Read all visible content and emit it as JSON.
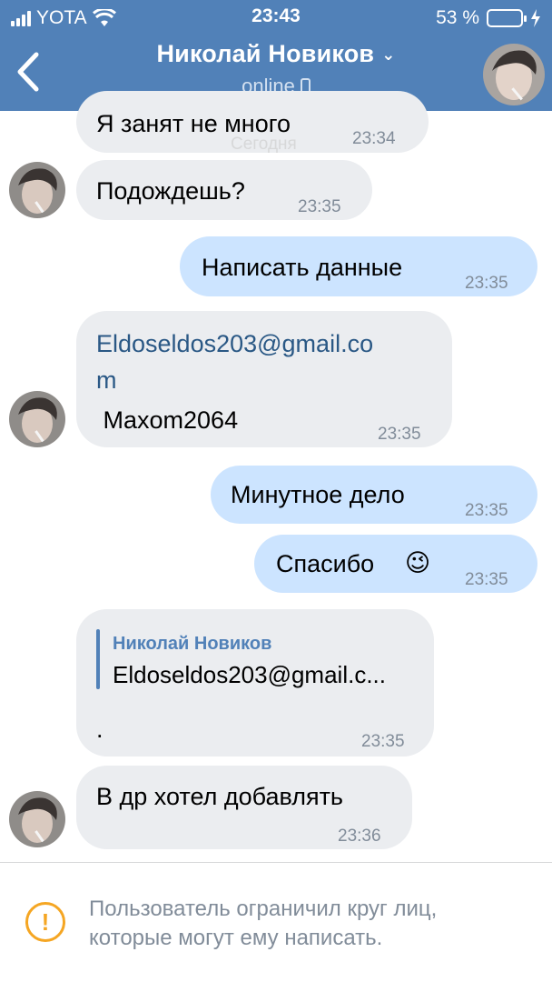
{
  "status_bar": {
    "carrier": "YOTA",
    "time": "23:43",
    "battery": "53 %"
  },
  "header": {
    "name": "Николай Новиков",
    "subtitle": "online"
  },
  "ghost_date": "Сегодня",
  "messages": [
    {
      "text": "Я занят не много",
      "time": "23:34"
    },
    {
      "text": "Подождешь?",
      "time": "23:35"
    },
    {
      "text": "Написать данные",
      "time": "23:35"
    },
    {
      "link_line1": "Eldoseldos203@gmail.co",
      "link_line2": "m",
      "text": " Maxom2064",
      "time": "23:35"
    },
    {
      "text": "Минутное дело",
      "time": "23:35"
    },
    {
      "text": "Спасибо",
      "emoji": "😉",
      "time": "23:35"
    },
    {
      "reply_name": "Николай Новиков",
      "reply_text": "Eldoseldos203@gmail.c...",
      "text": ".",
      "time": "23:35"
    },
    {
      "text": "В др хотел добавлять",
      "time": "23:36"
    }
  ],
  "notice": "Пользователь ограничил круг лиц, которые могут ему написать.",
  "colors": {
    "header": "#5181b8",
    "incoming": "#ebedf0",
    "outgoing": "#cce4ff",
    "link": "#2a5885",
    "warning": "#f5a623"
  }
}
